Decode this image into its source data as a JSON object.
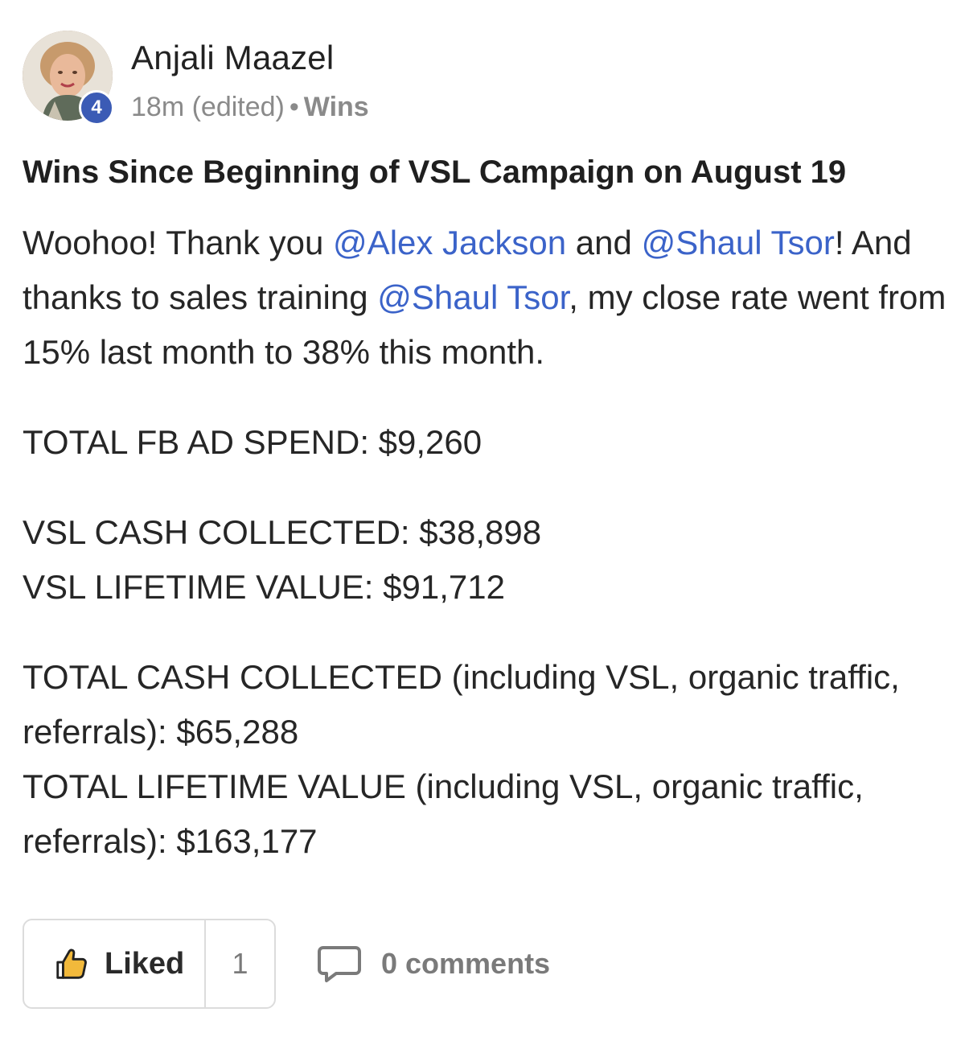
{
  "post": {
    "author": "Anjali Maazel",
    "level_badge": "4",
    "time": "18m (edited)",
    "separator": "•",
    "category": "Wins",
    "title": "Wins Since Beginning of VSL Campaign on August 19",
    "body": {
      "p1_text1": "Woohoo! Thank you ",
      "p1_mention1": "@Alex Jackson",
      "p1_text2": " and ",
      "p1_mention2": "@Shaul Tsor",
      "p1_text3": "! And thanks to sales training ",
      "p1_mention3": "@Shaul Tsor",
      "p1_text4": ", my close rate went from 15% last month to 38% this month.",
      "fb_ad_spend": "TOTAL FB AD SPEND: $9,260",
      "vsl_cash": "VSL CASH COLLECTED: $38,898",
      "vsl_ltv": "VSL LIFETIME VALUE: $91,712",
      "total_cash": "TOTAL CASH COLLECTED (including VSL, organic traffic, referrals): $65,288",
      "total_ltv": "TOTAL LIFETIME VALUE (including VSL, organic traffic, referrals): $163,177"
    }
  },
  "footer": {
    "like_label": "Liked",
    "like_count": "1",
    "comments_label": "0 comments"
  },
  "icons": {
    "like": "thumbs-up-icon",
    "comments": "speech-bubble-icon"
  },
  "colors": {
    "mention": "#3b63c9",
    "level_badge": "#3b5bb5",
    "meta": "#8a8a8a"
  }
}
